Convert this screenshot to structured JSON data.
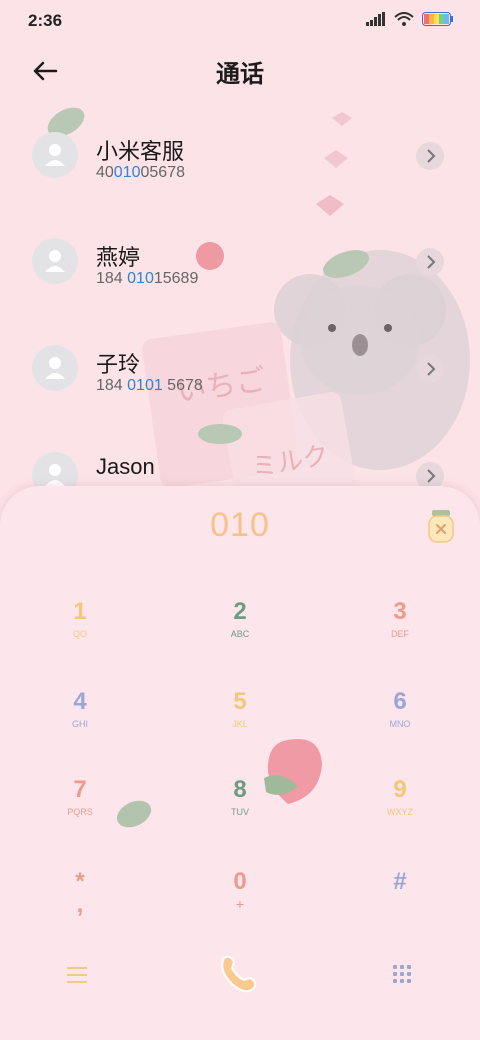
{
  "status": {
    "time": "2:36"
  },
  "header": {
    "title": "通话"
  },
  "contacts": [
    {
      "name": "小米客服",
      "num_pre": "40",
      "num_hl": "010",
      "num_post": "05678"
    },
    {
      "name": "燕婷",
      "num_pre": "184 ",
      "num_hl": "010",
      "num_post": "15689"
    },
    {
      "name": "子玲",
      "num_pre": "184 ",
      "num_hl": "0101",
      "num_post": " 5678"
    },
    {
      "name": "Jason",
      "num_pre": "",
      "num_hl": "",
      "num_post": ""
    }
  ],
  "dialpad": {
    "input": "010",
    "keys": [
      {
        "digit": "1",
        "letters": "QO",
        "color": "#f3c878"
      },
      {
        "digit": "2",
        "letters": "ABC",
        "color": "#6f9a84"
      },
      {
        "digit": "3",
        "letters": "DEF",
        "color": "#ee9a8e"
      },
      {
        "digit": "4",
        "letters": "GHI",
        "color": "#9aa6d6"
      },
      {
        "digit": "5",
        "letters": "JKL",
        "color": "#f3c878"
      },
      {
        "digit": "6",
        "letters": "MNO",
        "color": "#9aa6d6"
      },
      {
        "digit": "7",
        "letters": "PQRS",
        "color": "#ee9a8e"
      },
      {
        "digit": "8",
        "letters": "TUV",
        "color": "#6f9a84"
      },
      {
        "digit": "9",
        "letters": "WXYZ",
        "color": "#f3c878"
      },
      {
        "digit": "*",
        "letters": ",",
        "color": "#ee9a8e"
      },
      {
        "digit": "0",
        "letters": "+",
        "color": "#ee9a8e"
      },
      {
        "digit": "#",
        "letters": "",
        "color": "#9aa6d6"
      }
    ]
  }
}
